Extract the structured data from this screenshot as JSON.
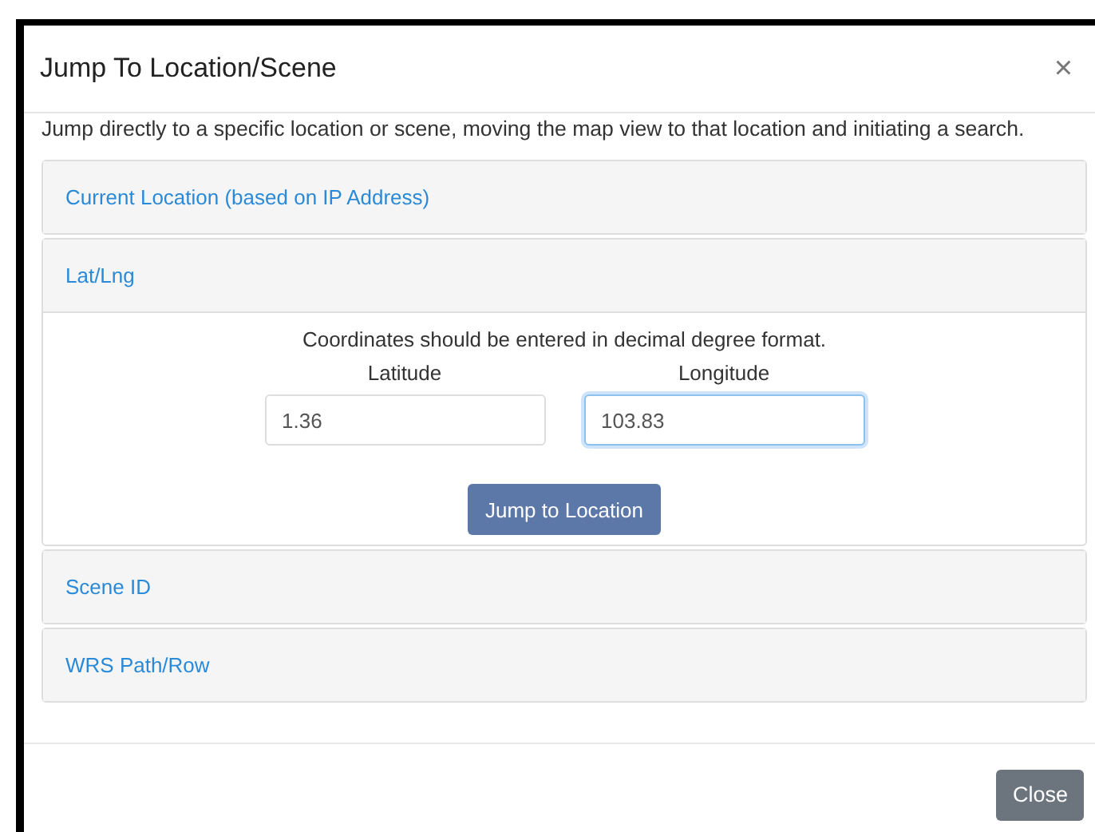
{
  "dialog": {
    "title": "Jump To Location/Scene",
    "close_icon": "×",
    "description": "Jump directly to a specific location or scene, moving the map view to that location and initiating a search.",
    "panels": [
      {
        "title": "Current Location (based on IP Address)",
        "expanded": false
      },
      {
        "title": "Lat/Lng",
        "expanded": true,
        "hint": "Coordinates should be entered in decimal degree format.",
        "fields": [
          {
            "label": "Latitude",
            "value": "1.36",
            "focused": false
          },
          {
            "label": "Longitude",
            "value": "103.83",
            "focused": true
          }
        ],
        "button": "Jump to Location"
      },
      {
        "title": "Scene ID",
        "expanded": false
      },
      {
        "title": "WRS Path/Row",
        "expanded": false
      }
    ],
    "footer_button": "Close"
  }
}
